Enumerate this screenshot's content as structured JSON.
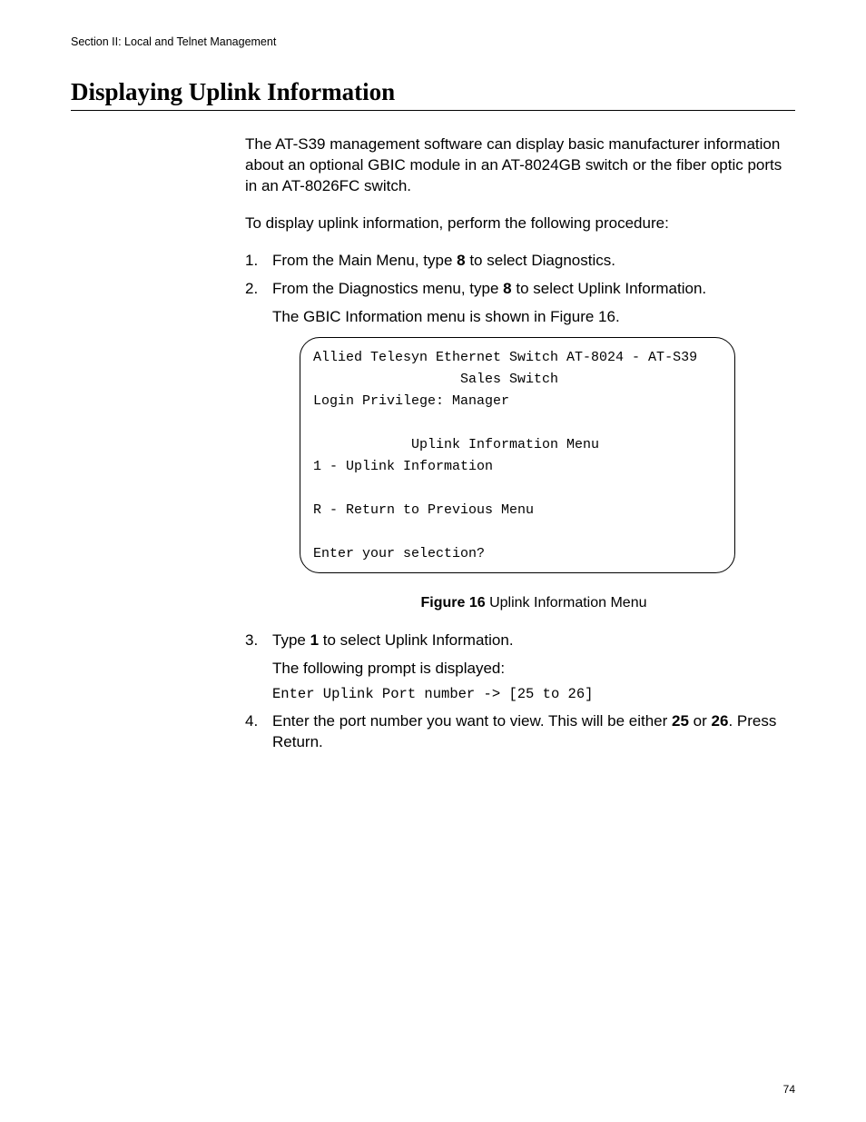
{
  "header": {
    "section": "Section II: Local and Telnet Management"
  },
  "title": "Displaying Uplink Information",
  "intro_p1": "The AT-S39 management software can display basic manufacturer information about an optional GBIC module in an AT-8024GB switch or the fiber optic ports in an AT-8026FC switch.",
  "intro_p2": "To display uplink information, perform the following procedure:",
  "step1_a": "From the Main Menu, type ",
  "step1_b": "8",
  "step1_c": " to select Diagnostics.",
  "step2_a": "From the Diagnostics menu, type ",
  "step2_b": "8",
  "step2_c": " to select Uplink Information.",
  "step2_sub": "The GBIC Information menu is shown in Figure 16.",
  "terminal": {
    "line1": "Allied Telesyn Ethernet Switch AT-8024 - AT-S39",
    "line2_indent": "                  Sales Switch",
    "line3": "Login Privilege: Manager",
    "line4_indent": "            Uplink Information Menu",
    "line5": "1 - Uplink Information",
    "line6": "R - Return to Previous Menu",
    "line7": "Enter your selection?"
  },
  "figure": {
    "label": "Figure 16",
    "caption": "  Uplink Information Menu"
  },
  "step3_a": "Type ",
  "step3_b": "1",
  "step3_c": " to select Uplink Information.",
  "step3_sub": "The following prompt is displayed:",
  "step3_mono": "Enter Uplink Port number -> [25 to 26]",
  "step4_a": "Enter the port number you want to view. This will be either ",
  "step4_b": "25",
  "step4_c": " or ",
  "step4_d": "26",
  "step4_e": ". Press Return.",
  "page_number": "74"
}
